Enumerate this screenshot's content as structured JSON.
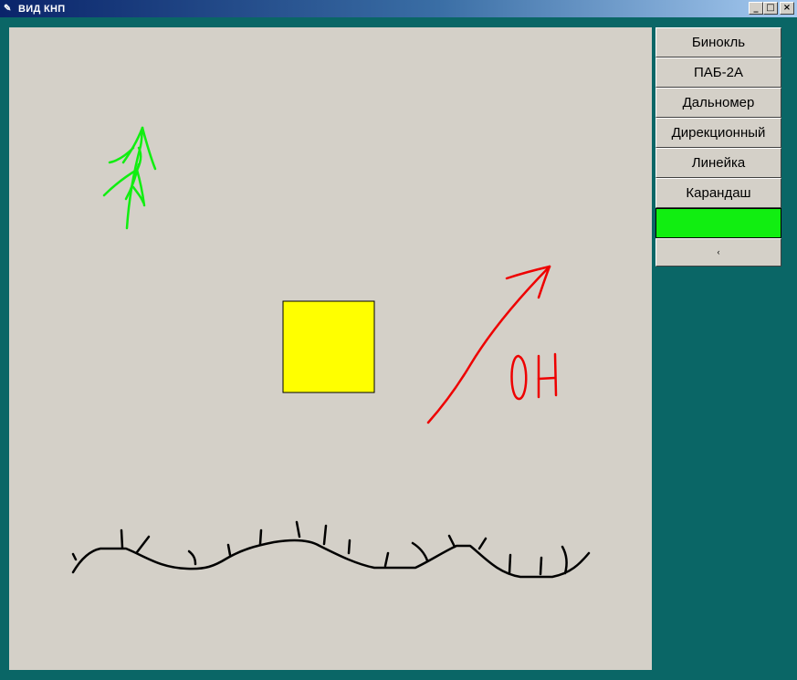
{
  "window": {
    "title": "ВИД КНП",
    "icon": "feather-icon",
    "controls": {
      "minimize": "_",
      "maximize": "□",
      "close": "×"
    }
  },
  "tools": {
    "binoculars": "Бинокль",
    "pab": "ПАБ-2А",
    "rangefinder": "Дальномер",
    "directional": "Дирекционный",
    "ruler": "Линейка",
    "pencil": "Карандаш",
    "color_swatch": "",
    "extra": "‹"
  },
  "colors": {
    "desktop": "#0a6666",
    "canvas": "#d4d0c8",
    "selected_color": "#11ee11",
    "square": "#ffff00",
    "drawing_red": "#ee0000",
    "drawing_green": "#11ee11",
    "drawing_black": "#000000"
  }
}
